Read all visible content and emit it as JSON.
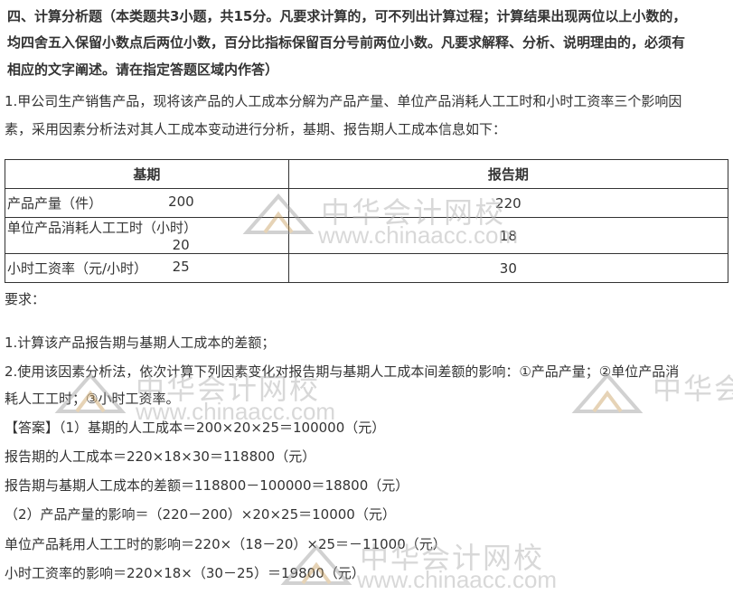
{
  "heading": {
    "line1": "四、计算分析题（本类题共3小题，共15分。凡要求计算的，可不列出计算过程；计算结果出现两位以上小数的，",
    "line2": "均四舍五入保留小数点后两位小数，百分比指标保留百分号前两位小数。凡要求解释、分析、说明理由的，必须有",
    "line3": "相应的文字阐述。请在指定答题区域内作答）"
  },
  "question": {
    "line1": "1.甲公司生产销售产品，现将该产品的人工成本分解为产品产量、单位产品消耗人工工时和小时工资率三个影响因",
    "line2": "素，采用因素分析法对其人工成本变动进行分析，基期、报告期人工成本信息如下："
  },
  "table": {
    "headers": [
      "基期",
      "报告期"
    ],
    "rows": [
      {
        "label": "产品产量（件）",
        "base": "200",
        "report": "220"
      },
      {
        "label": "单位产品消耗人工工时（小时）",
        "base": "20",
        "report": "18"
      },
      {
        "label": "小时工资率（元/小时）",
        "base": "25",
        "report": "30"
      }
    ]
  },
  "requirements": {
    "title": "要求：",
    "item1": "1.计算该产品报告期与基期人工成本的差额；",
    "item2_line1": "2.使用该因素分析法，依次计算下列因素变化对报告期与基期人工成本间差额的影响：①产品产量；②单位产品消",
    "item2_line2": "耗人工工时；③小时工资率。"
  },
  "answer": {
    "line1": "【答案】（1）基期的人工成本＝200×20×25＝100000（元）",
    "line2": "报告期的人工成本＝220×18×30＝118800（元）",
    "line3": "报告期与基期人工成本的差额＝118800－100000＝18800（元）",
    "line4": "（2）产品产量的影响＝（220－200）×20×25＝10000（元）",
    "line5": "单位产品耗用人工工时的影响＝220×（18－20）×25＝－11000（元）",
    "line6": "小时工资率的影响＝220×18×（30－25）＝19800（元）"
  },
  "watermark": {
    "cn": "中华会计网校",
    "en": "www.chinaacc.com",
    "cn_partial": "中华会"
  }
}
